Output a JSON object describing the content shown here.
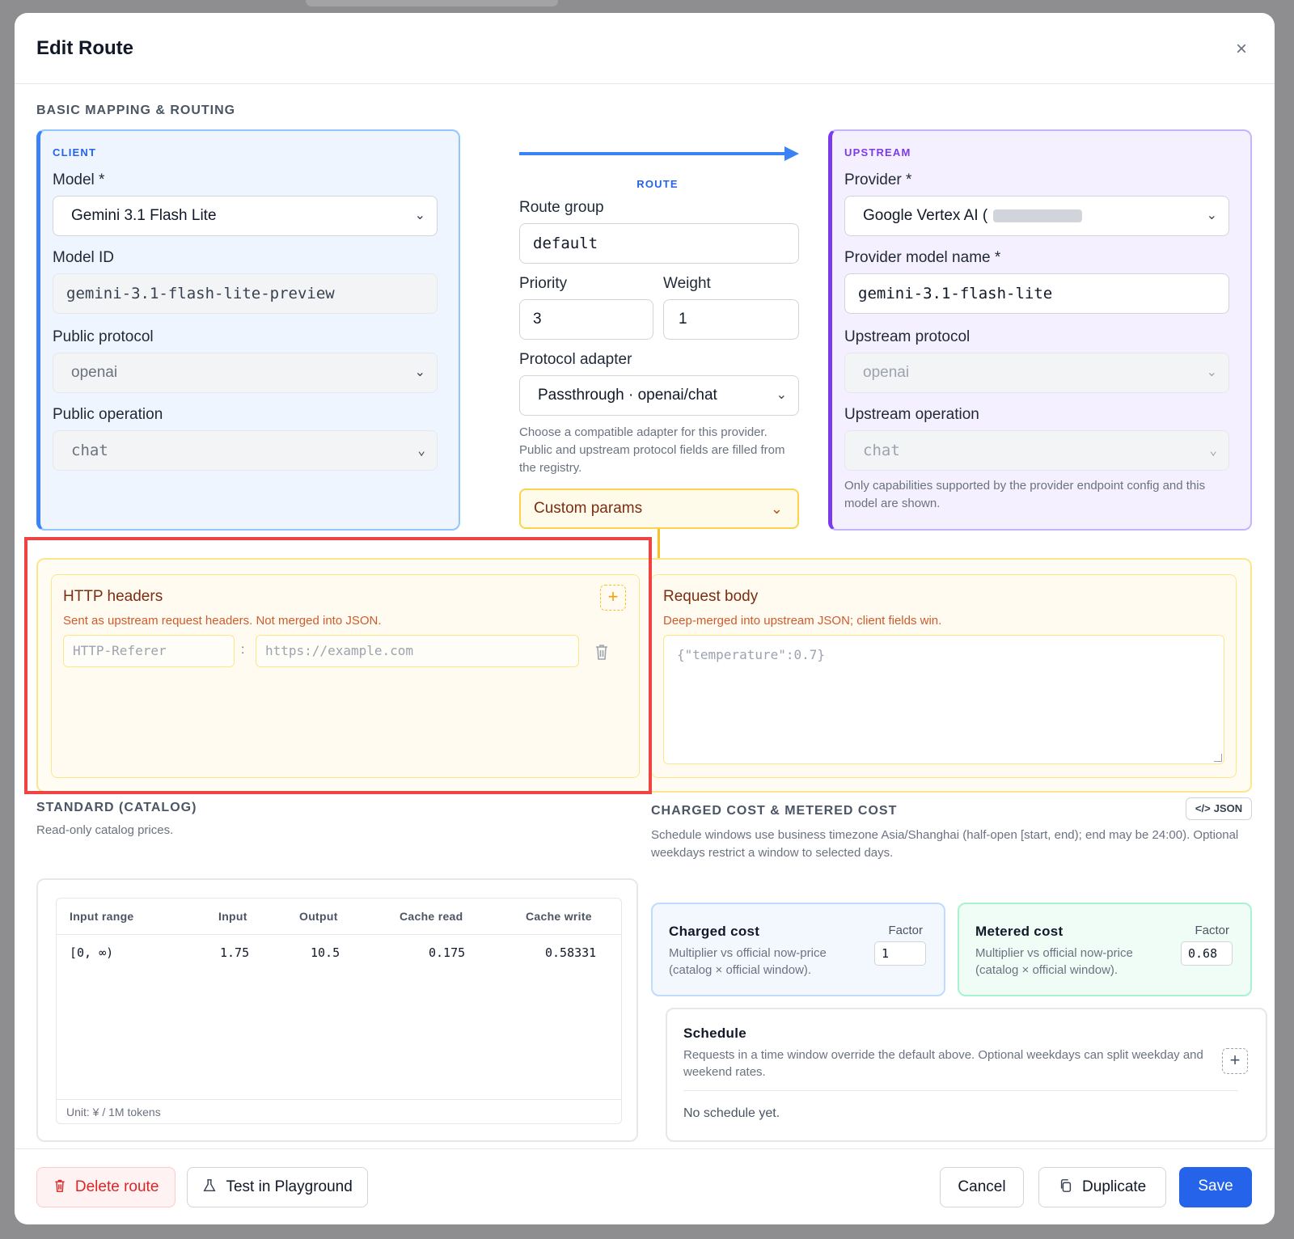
{
  "modal": {
    "title": "Edit Route"
  },
  "section_basic": "BASIC MAPPING & ROUTING",
  "client": {
    "tag": "CLIENT",
    "model_label": "Model *",
    "model_value": "Gemini 3.1 Flash Lite",
    "model_id_label": "Model ID",
    "model_id_value": "gemini-3.1-flash-lite-preview",
    "public_protocol_label": "Public protocol",
    "public_protocol_value": "openai",
    "public_operation_label": "Public operation",
    "public_operation_value": "chat"
  },
  "route": {
    "tag": "ROUTE",
    "group_label": "Route group",
    "group_value": "default",
    "priority_label": "Priority",
    "priority_value": "3",
    "weight_label": "Weight",
    "weight_value": "1",
    "adapter_label": "Protocol adapter",
    "adapter_value": "Passthrough · openai/chat",
    "adapter_hint": "Choose a compatible adapter for this provider. Public and upstream protocol fields are filled from the registry.",
    "custom_params_label": "Custom params"
  },
  "upstream": {
    "tag": "UPSTREAM",
    "provider_label": "Provider *",
    "provider_value": "Google Vertex AI (",
    "provider_model_label": "Provider model name *",
    "provider_model_value": "gemini-3.1-flash-lite",
    "upstream_protocol_label": "Upstream protocol",
    "upstream_protocol_value": "openai",
    "upstream_operation_label": "Upstream operation",
    "upstream_operation_value": "chat",
    "operation_hint": "Only capabilities supported by the provider endpoint config and this model are shown."
  },
  "http_headers": {
    "title": "HTTP headers",
    "subtitle": "Sent as upstream request headers. Not merged into JSON.",
    "key_placeholder": "HTTP-Referer",
    "separator": ":",
    "value_placeholder": "https://example.com"
  },
  "request_body": {
    "title": "Request body",
    "subtitle": "Deep-merged into upstream JSON; client fields win.",
    "placeholder": "{\"temperature\":0.7}"
  },
  "standard": {
    "title": "STANDARD (CATALOG)",
    "subtitle": "Read-only catalog prices.",
    "columns": [
      "Input range",
      "Input",
      "Output",
      "Cache read",
      "Cache write"
    ],
    "rows": [
      [
        "[0, ∞)",
        "1.75",
        "10.5",
        "0.175",
        "0.58331"
      ]
    ],
    "unit": "Unit: ¥ / 1M tokens"
  },
  "costs": {
    "title": "CHARGED COST & METERED COST",
    "json_button": "JSON",
    "description": "Schedule windows use business timezone Asia/Shanghai (half-open [start, end); end may be 24:00). Optional weekdays restrict a window to selected days.",
    "charged": {
      "title": "Charged cost",
      "desc": "Multiplier vs official now-price (catalog × official window).",
      "factor_label": "Factor",
      "factor_value": "1"
    },
    "metered": {
      "title": "Metered cost",
      "desc": "Multiplier vs official now-price (catalog × official window).",
      "factor_label": "Factor",
      "factor_value": "0.68"
    },
    "schedule": {
      "title": "Schedule",
      "desc": "Requests in a time window override the default above. Optional weekdays can split weekday and weekend rates.",
      "empty": "No schedule yet."
    }
  },
  "footer": {
    "delete": "Delete route",
    "test": "Test in Playground",
    "cancel": "Cancel",
    "duplicate": "Duplicate",
    "save": "Save"
  },
  "colors": {
    "primary": "#2563eb",
    "client_accent": "#3b82f6",
    "upstream_accent": "#7c3aed",
    "params_accent": "#fbbf24",
    "danger": "#dc2626",
    "highlight": "#ef4444"
  }
}
